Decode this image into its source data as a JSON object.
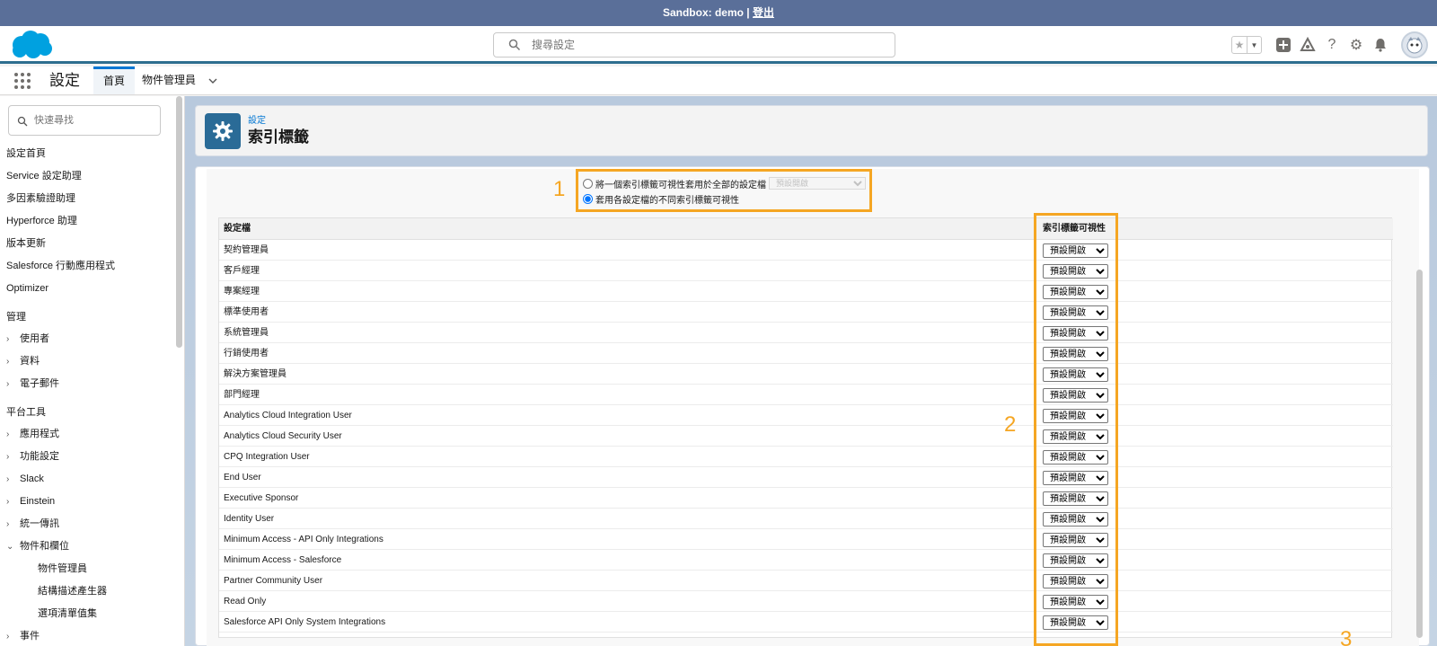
{
  "sandbox": {
    "text": "Sandbox: demo |",
    "logout": "登出"
  },
  "header": {
    "search_placeholder": "搜尋設定"
  },
  "nav": {
    "app_title": "設定",
    "tab_home": "首頁",
    "tab_object_manager": "物件管理員"
  },
  "sidebar": {
    "quick_find_placeholder": "快速尋找",
    "top_items": [
      "設定首頁",
      "Service 設定助理",
      "多因素驗證助理",
      "Hyperforce 助理",
      "版本更新",
      "Salesforce 行動應用程式",
      "Optimizer"
    ],
    "admin_heading": "管理",
    "admin_items": [
      "使用者",
      "資料",
      "電子郵件"
    ],
    "platform_heading": "平台工具",
    "platform_items": [
      "應用程式",
      "功能設定",
      "Slack",
      "Einstein",
      "統一傳訊",
      "物件和欄位"
    ],
    "objects_subitems": [
      "物件管理員",
      "結構描述產生器",
      "選項清單值集"
    ],
    "last_item": "事件"
  },
  "page": {
    "breadcrumb": "設定",
    "title": "索引標籤"
  },
  "options": {
    "apply_all_label": "將一個索引標籤可視性套用於全部的設定檔",
    "apply_all_default": "預設開啟",
    "apply_each_label": "套用各設定檔的不同索引標籤可視性"
  },
  "annotations": {
    "n1": "1",
    "n2": "2",
    "n3": "3"
  },
  "table": {
    "col_profile": "設定檔",
    "col_visibility": "索引標籤可視性",
    "default_value": "預設開啟",
    "rows": [
      "契約管理員",
      "客戶經理",
      "專案經理",
      "標準使用者",
      "系統管理員",
      "行銷使用者",
      "解決方案管理員",
      "部門經理",
      "Analytics Cloud Integration User",
      "Analytics Cloud Security User",
      "CPQ Integration User",
      "End User",
      "Executive Sponsor",
      "Identity User",
      "Minimum Access - API Only Integrations",
      "Minimum Access - Salesforce",
      "Partner Community User",
      "Read Only",
      "Salesforce API Only System Integrations"
    ]
  }
}
